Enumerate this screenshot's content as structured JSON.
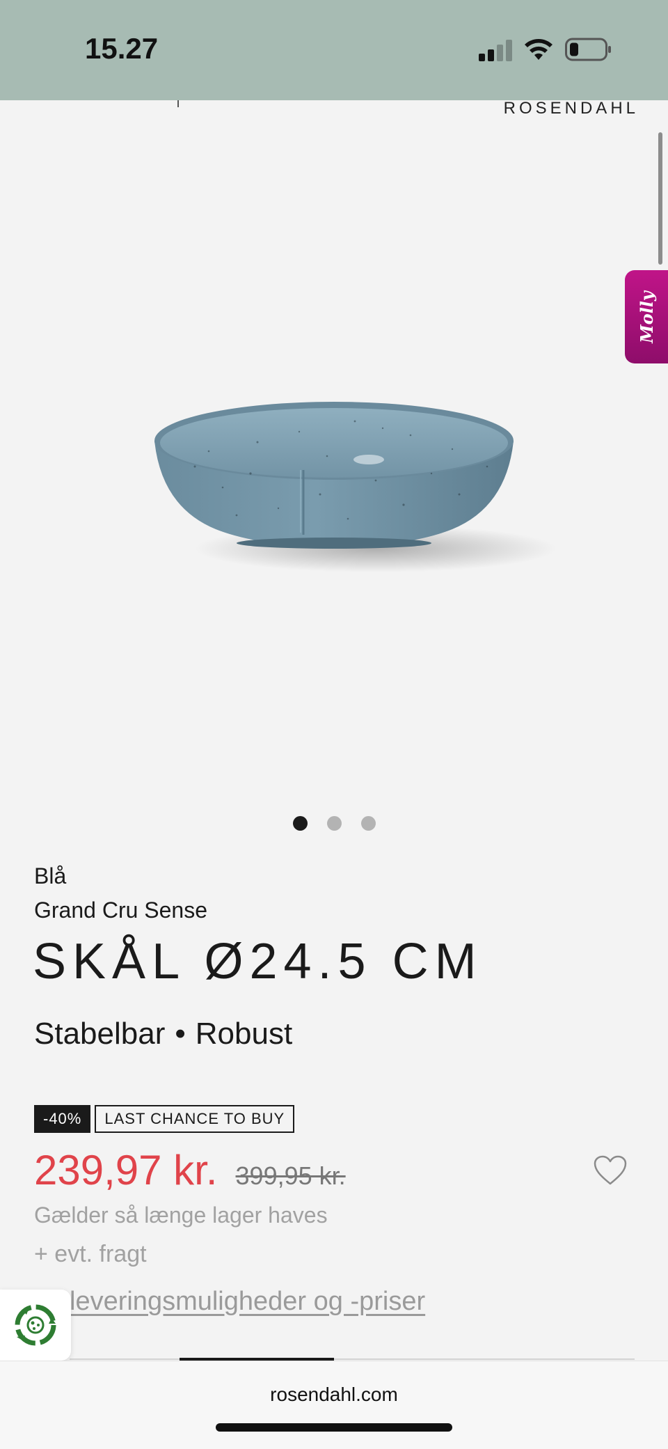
{
  "status_bar": {
    "time": "15.27"
  },
  "header": {
    "brand": "ROSENDAHL"
  },
  "side_tab": {
    "label": "Molly"
  },
  "carousel": {
    "dots": 3,
    "active_index": 0
  },
  "product": {
    "variant": "Blå",
    "collection": "Grand Cru Sense",
    "title": "SKÅL Ø24.5 CM",
    "features": [
      "Stabelbar",
      "Robust"
    ],
    "features_separator": "•",
    "badge_discount": "-40%",
    "badge_last_chance": "LAST CHANCE TO BUY",
    "price_now": "239,97 kr.",
    "price_old": "399,95 kr.",
    "stock_note": "Gælder så længe lager haves",
    "freight_note": "+ evt. fragt",
    "delivery_link": "leveringsmuligheder og -priser"
  },
  "browser": {
    "url": "rosendahl.com"
  },
  "colors": {
    "status_bar_bg": "#a7bbb3",
    "page_bg": "#f3f3f3",
    "sale_price": "#e0434a",
    "molly_tab": "#b01282",
    "bowl": "#6f91a3"
  },
  "icons": [
    "signal-icon",
    "wifi-icon",
    "battery-icon",
    "heart-icon",
    "recycle-icon"
  ]
}
